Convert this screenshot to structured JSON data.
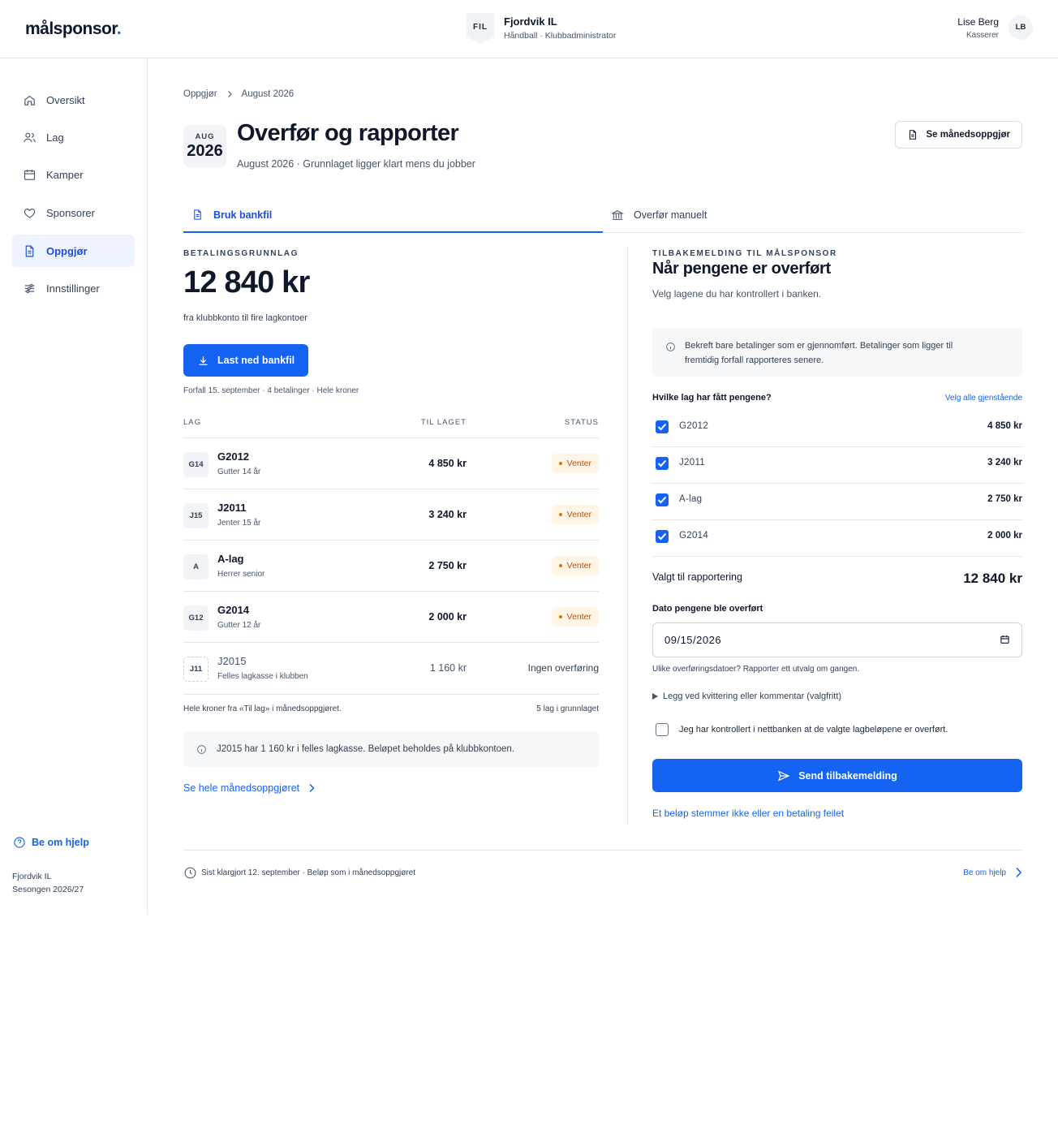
{
  "brand": {
    "name": "målsponsor",
    "dot": "."
  },
  "club": {
    "badge": "FIL",
    "name": "Fjordvik IL",
    "role": "Håndball · Klubbadministrator"
  },
  "user": {
    "name": "Lise Berg",
    "role": "Kasserer",
    "initials": "LB"
  },
  "nav": [
    {
      "label": "Oversikt",
      "icon": "home-icon"
    },
    {
      "label": "Lag",
      "icon": "users-icon"
    },
    {
      "label": "Kamper",
      "icon": "calendar-icon"
    },
    {
      "label": "Sponsorer",
      "icon": "heart-icon"
    },
    {
      "label": "Oppgjør",
      "icon": "document-icon",
      "active": true
    },
    {
      "label": "Innstillinger",
      "icon": "sliders-icon"
    }
  ],
  "sidebar_footer": {
    "help": "Be om hjelp",
    "club": "Fjordvik IL",
    "season": "Sesongen 2026/27"
  },
  "breadcrumb": {
    "parent": "Oppgjør",
    "current": "August 2026"
  },
  "date_badge": {
    "month": "AUG",
    "year": "2026"
  },
  "page": {
    "title": "Overfør og rapporter",
    "subtitle": "August 2026 · Grunnlaget ligger klart mens du jobber",
    "monthly_button": "Se månedsoppgjør"
  },
  "tabs": [
    {
      "label": "Bruk bankfil",
      "active": true
    },
    {
      "label": "Overfør manuelt",
      "active": false
    }
  ],
  "basis": {
    "overline": "BETALINGSGRUNNLAG",
    "amount": "12 840 kr",
    "description": "fra klubbkonto til fire lagkontoer",
    "download_button": "Last ned bankfil",
    "meta": "Forfall 15. september · 4 betalinger · Hele kroner",
    "columns": {
      "team": "LAG",
      "amount": "TIL LAGET",
      "status": "STATUS"
    },
    "rows": [
      {
        "code": "G14",
        "name": "G2012",
        "sub": "Gutter 14 år",
        "amount": "4 850 kr",
        "status": "Venter"
      },
      {
        "code": "J15",
        "name": "J2011",
        "sub": "Jenter 15 år",
        "amount": "3 240 kr",
        "status": "Venter"
      },
      {
        "code": "A",
        "name": "A-lag",
        "sub": "Herrer senior",
        "amount": "2 750 kr",
        "status": "Venter"
      },
      {
        "code": "G12",
        "name": "G2014",
        "sub": "Gutter 12 år",
        "amount": "2 000 kr",
        "status": "Venter"
      }
    ],
    "excluded": {
      "code": "J11",
      "name": "J2015",
      "sub": "Felles lagkasse i klubben",
      "amount": "1 160 kr",
      "status": "Ingen overføring"
    },
    "footer_left": "Hele kroner fra «Til lag» i månedsoppgjøret.",
    "footer_right": "5 lag i grunnlaget",
    "note": "J2015 har 1 160 kr i felles lagkasse. Beløpet beholdes på klubbkontoen.",
    "link": "Se hele månedsoppgjøret"
  },
  "feedback": {
    "overline": "TILBAKEMELDING TIL MÅLSPONSOR",
    "title": "Når pengene er overført",
    "subtitle": "Velg lagene du har kontrollert i banken.",
    "info_line1": "Bekreft bare betalinger som er gjennomført. Betalinger som ligger til",
    "info_line2": "fremtidig forfall rapporteres senere.",
    "question": "Hvilke lag har fått pengene?",
    "select_all": "Velg alle gjenstående",
    "items": [
      {
        "name": "G2012",
        "amount": "4 850 kr",
        "checked": true
      },
      {
        "name": "J2011",
        "amount": "3 240 kr",
        "checked": true
      },
      {
        "name": "A-lag",
        "amount": "2 750 kr",
        "checked": true
      },
      {
        "name": "G2014",
        "amount": "2 000 kr",
        "checked": true
      }
    ],
    "total_label": "Valgt til rapportering",
    "total_amount": "12 840 kr",
    "date_label": "Dato pengene ble overført",
    "date_value": "09/15/2026",
    "hint": "Ulike overføringsdatoer? Rapporter ett utvalg om gangen.",
    "details": "Legg ved kvittering eller kommentar (valgfritt)",
    "confirm": "Jeg har kontrollert i nettbanken at de valgte lagbeløpene er overført.",
    "send_button": "Send tilbakemelding",
    "problem_link": "Et beløp stemmer ikke eller en betaling feilet"
  },
  "footer": {
    "left": "Sist klargjort 12. september · Beløp som i månedsoppgjøret",
    "right": "Be om hjelp"
  },
  "colors": {
    "accent": "#1463f3",
    "pending_bg": "#fff4e5",
    "pending_text": "#b45309"
  }
}
